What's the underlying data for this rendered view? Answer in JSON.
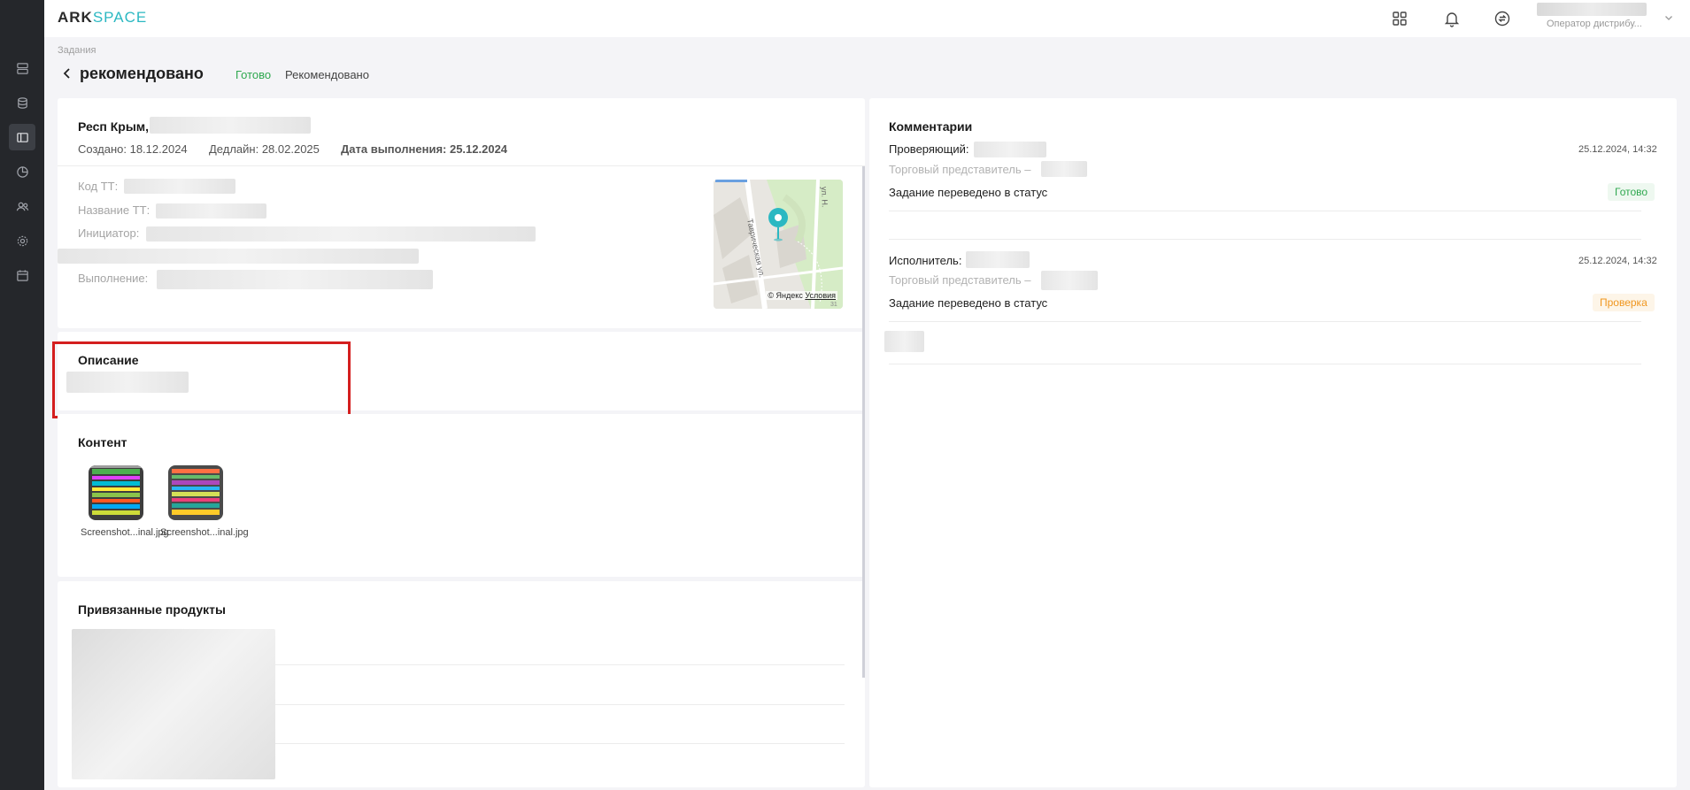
{
  "app": {
    "logo_main": "ARK",
    "logo_accent": "SPACE"
  },
  "header": {
    "user_role": "Оператор дистрибу..."
  },
  "breadcrumb": "Задания",
  "page": {
    "title": "рекомендовано",
    "status_ready": "Готово",
    "status_recommended": "Рекомендовано"
  },
  "task": {
    "address_prefix": "Респ Крым,",
    "created": "Создано: 18.12.2024",
    "deadline": "Дедлайн: 28.02.2025",
    "completed_label": "Дата выполнения: 25.12.2024",
    "code_label": "Код ТТ:",
    "name_label": "Название ТТ:",
    "initiator_label": "Инициатор:",
    "execution_label": "Выполнение:",
    "map_credit_prefix": "© Яндекс",
    "map_credit_link": "Условия"
  },
  "description": {
    "title": "Описание"
  },
  "content": {
    "title": "Контент",
    "files": [
      {
        "name": "Screenshot...inal.jpg"
      },
      {
        "name": "Screenshot...inal.jpg"
      }
    ]
  },
  "linked_products": {
    "title": "Привязанные продукты"
  },
  "comments": {
    "title": "Комментарии",
    "items": [
      {
        "role_label": "Проверяющий:",
        "date": "25.12.2024, 14:32",
        "subtitle": "Торговый представитель –",
        "text": "Задание переведено в статус",
        "status": "Готово",
        "status_color": "#2fa84f"
      },
      {
        "role_label": "Исполнитель:",
        "date": "25.12.2024, 14:32",
        "subtitle": "Торговый представитель –",
        "text": "Задание переведено в статус",
        "status": "Проверка",
        "status_color": "#f0961e"
      }
    ]
  },
  "colors": {
    "sidebar_bg": "#25272b",
    "accent_teal": "#2bb8c2",
    "status_green": "#2fa84f",
    "status_orange": "#f0961e",
    "highlight_red": "#d41e1e"
  }
}
